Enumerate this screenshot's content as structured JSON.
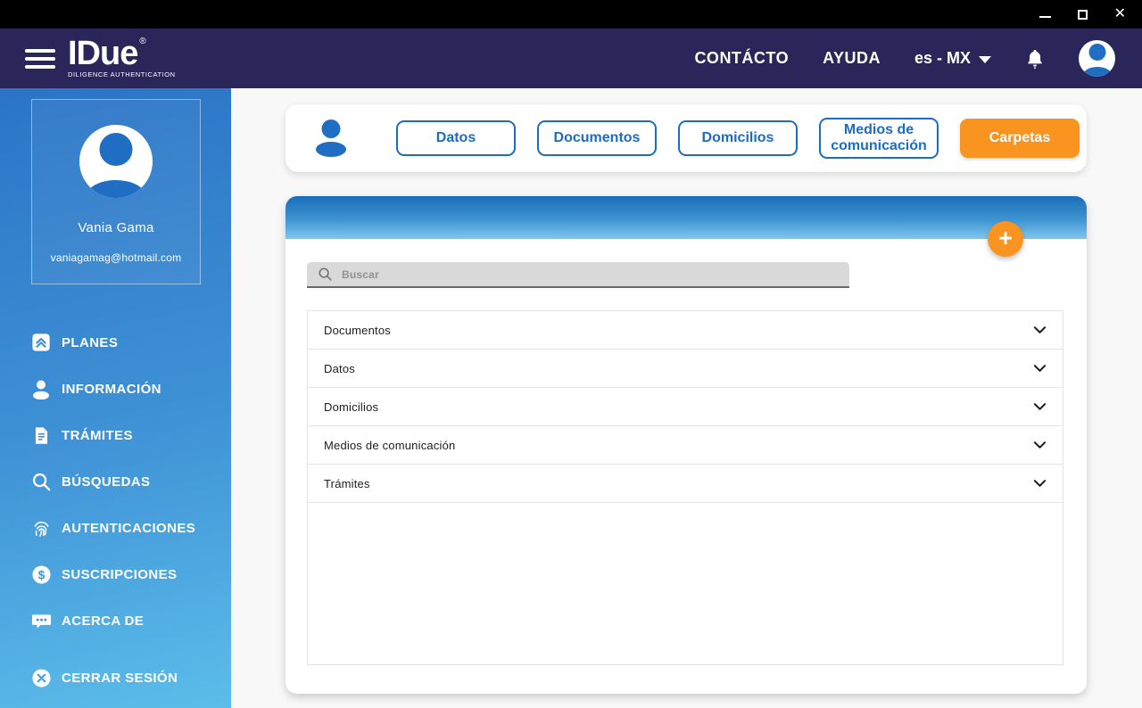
{
  "titlebar": {
    "close_glyph": "✕"
  },
  "header": {
    "logo": {
      "name": "IDue",
      "registered": "®",
      "tagline": "DILIGENCE AUTHENTICATION"
    },
    "nav": [
      {
        "label": "CONTÁCTO"
      },
      {
        "label": "AYUDA"
      }
    ],
    "language": {
      "selected": "es - MX"
    },
    "icons": {
      "bell": "bell-icon",
      "avatar": "user-avatar"
    }
  },
  "sidebar": {
    "user": {
      "name": "Vania Gama",
      "email": "vaniagamag@hotmail.com"
    },
    "items": [
      {
        "label": "PLANES",
        "icon": "plans-icon"
      },
      {
        "label": "INFORMACIÓN",
        "icon": "person-icon"
      },
      {
        "label": "TRÁMITES",
        "icon": "document-icon"
      },
      {
        "label": "BÚSQUEDAS",
        "icon": "search-icon"
      },
      {
        "label": "AUTENTICACIONES",
        "icon": "fingerprint-icon"
      },
      {
        "label": "SUSCRIPCIONES",
        "icon": "dollar-icon"
      },
      {
        "label": "ACERCA DE",
        "icon": "chat-icon"
      }
    ],
    "logout": {
      "label": "CERRAR SESIÓN",
      "icon": "logout-icon"
    },
    "icons": {
      "dollar_glyph": "$"
    }
  },
  "tabs": [
    {
      "label": "Datos"
    },
    {
      "label": "Documentos"
    },
    {
      "label": "Domicilios"
    },
    {
      "label": "Medios de comunicación"
    },
    {
      "label": "Carpetas"
    }
  ],
  "panel": {
    "add_button_glyph": "+",
    "search": {
      "placeholder": "Buscar"
    },
    "accordion": [
      {
        "label": "Documentos"
      },
      {
        "label": "Datos"
      },
      {
        "label": "Domicilios"
      },
      {
        "label": "Medios de comunicación"
      },
      {
        "label": "Trámites"
      }
    ]
  },
  "colors": {
    "titlebar_bg": "#000000",
    "header_bg": "#2A2659",
    "accent_blue": "#1B6CC4",
    "accent_orange": "#F8941F",
    "sidebar_gradient_top": "#2B74C6",
    "sidebar_gradient_bottom": "#5CBDEA",
    "panel_header_gradient_top": "#1A6DB8",
    "panel_header_gradient_bottom": "#7FC8ED",
    "search_bg": "#D9D9D9"
  }
}
